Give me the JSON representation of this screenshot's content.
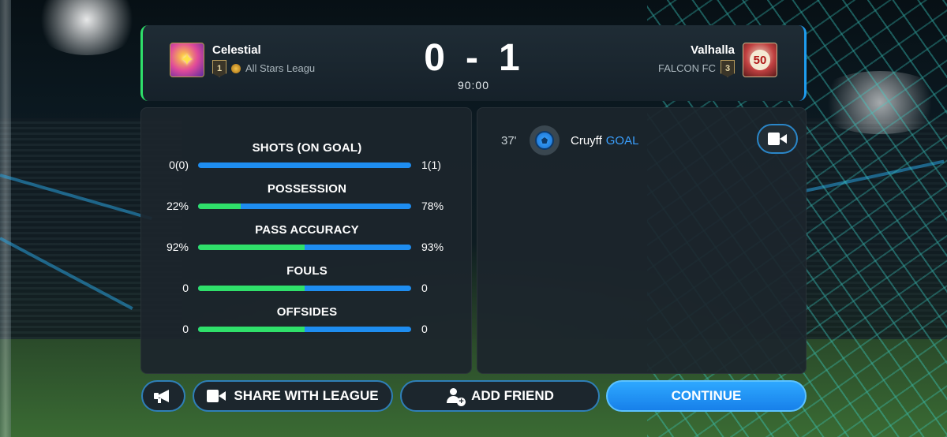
{
  "colors": {
    "home_accent": "#2fe06a",
    "away_accent": "#1e8df0",
    "primary_button": "#1780ea",
    "goal_text": "#3aa0ff"
  },
  "match": {
    "home": {
      "name": "Celestial",
      "rank": "1",
      "league": "All Stars Leagu"
    },
    "away": {
      "name": "Valhalla",
      "rank": "3",
      "club": "FALCON FC",
      "crest_number": "50"
    },
    "score_home": "0",
    "score_separator": "-",
    "score_away": "1",
    "time": "90:00"
  },
  "stats": [
    {
      "label": "SHOTS (ON GOAL)",
      "home": "0(0)",
      "away": "1(1)",
      "home_share": 0
    },
    {
      "label": "POSSESSION",
      "home": "22%",
      "away": "78%",
      "home_share": 0.2
    },
    {
      "label": "PASS ACCURACY",
      "home": "92%",
      "away": "93%",
      "home_share": 0.5
    },
    {
      "label": "FOULS",
      "home": "0",
      "away": "0",
      "home_share": 0.5
    },
    {
      "label": "OFFSIDES",
      "home": "0",
      "away": "0",
      "home_share": 0.5
    }
  ],
  "events": [
    {
      "minute": "37'",
      "player": "Cruyff",
      "type": "GOAL",
      "icon": "ball-icon"
    }
  ],
  "buttons": {
    "announce_icon": "megaphone-icon",
    "share": "SHARE WITH LEAGUE",
    "add_friend": "ADD FRIEND",
    "continue": "CONTINUE"
  }
}
